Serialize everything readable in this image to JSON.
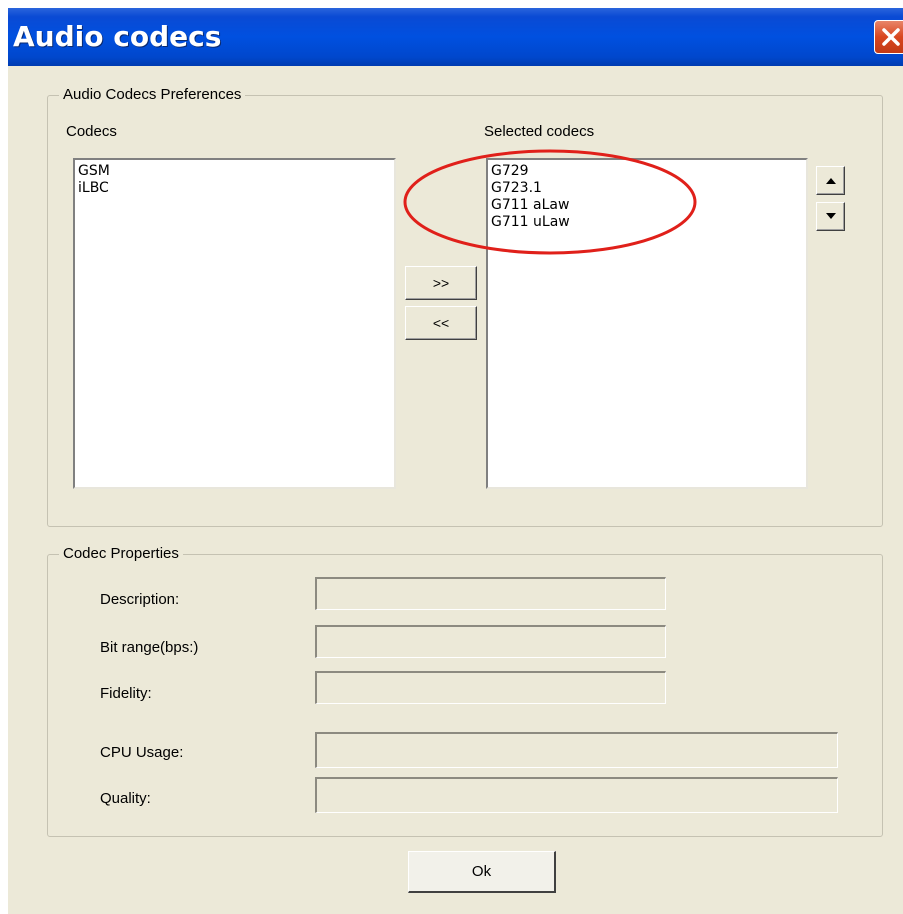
{
  "window": {
    "title": "Audio codecs"
  },
  "preferences": {
    "legend": "Audio Codecs Preferences",
    "codecs_label": "Codecs",
    "selected_label": "Selected codecs",
    "available_codecs": [
      "GSM",
      "iLBC"
    ],
    "selected_codecs": [
      "G729",
      "G723.1",
      "G711 aLaw",
      "G711 uLaw"
    ],
    "add_button": ">>",
    "remove_button": "<<",
    "move_up_icon": "triangle-up-icon",
    "move_down_icon": "triangle-down-icon"
  },
  "properties": {
    "legend": "Codec Properties",
    "description_label": "Description:",
    "description_value": "",
    "bit_range_label": "Bit range(bps:)",
    "bit_range_value": "",
    "fidelity_label": "Fidelity:",
    "fidelity_value": "",
    "cpu_usage_label": "CPU Usage:",
    "cpu_usage_value": "",
    "quality_label": "Quality:",
    "quality_value": ""
  },
  "footer": {
    "ok_label": "Ok"
  },
  "colors": {
    "titlebar": "#0050e0",
    "dialog_bg": "#ece9d8",
    "annotation": "#e0201a",
    "close_button": "#d9461f"
  }
}
